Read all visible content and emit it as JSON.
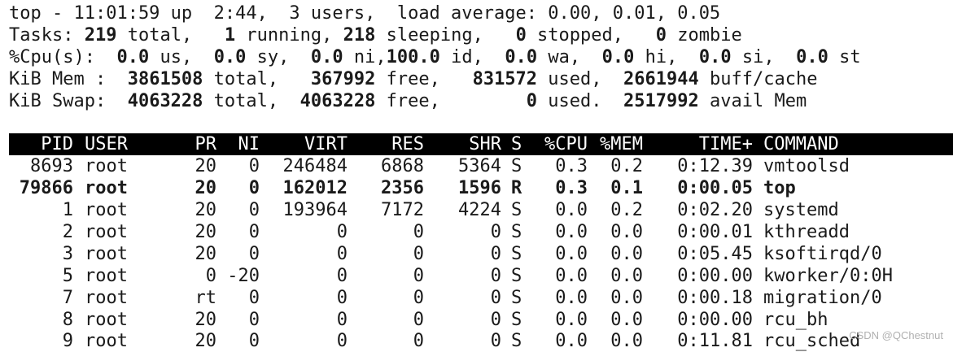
{
  "summary": {
    "l1": {
      "prefix": "top - 11:01:59 up  2:44,  3 users,  load average: 0.00, 0.01, 0.05"
    },
    "l2": {
      "label": "Tasks: ",
      "total": "219",
      "total_txt": " total,   ",
      "running": "1",
      "running_txt": " running, ",
      "sleeping": "218",
      "sleeping_txt": " sleeping,   ",
      "stopped": "0",
      "stopped_txt": " stopped,   ",
      "zombie": "0",
      "zombie_txt": " zombie"
    },
    "l3": {
      "label": "%Cpu(s):  ",
      "us": "0.0",
      "us_txt": " us,  ",
      "sy": "0.0",
      "sy_txt": " sy,  ",
      "ni": "0.0",
      "ni_txt": " ni,",
      "id": "100.0",
      "id_txt": " id,  ",
      "wa": "0.0",
      "wa_txt": " wa,  ",
      "hi": "0.0",
      "hi_txt": " hi,  ",
      "si": "0.0",
      "si_txt": " si,  ",
      "st": "0.0",
      "st_txt": " st"
    },
    "l4": {
      "label": "KiB Mem :  ",
      "total": "3861508",
      "total_txt": " total,   ",
      "free": "367992",
      "free_txt": " free,   ",
      "used": "831572",
      "used_txt": " used,  ",
      "buff": "2661944",
      "buff_txt": " buff/cache"
    },
    "l5": {
      "label": "KiB Swap:  ",
      "total": "4063228",
      "total_txt": " total,  ",
      "free": "4063228",
      "free_txt": " free,        ",
      "used": "0",
      "used_txt": " used.  ",
      "avail": "2517992",
      "avail_txt": " avail Mem"
    }
  },
  "columns": [
    "PID",
    "USER",
    "PR",
    "NI",
    "VIRT",
    "RES",
    "SHR",
    "S",
    "%CPU",
    "%MEM",
    "TIME+",
    "COMMAND"
  ],
  "processes": [
    {
      "pid": "8693",
      "user": "root",
      "pr": "20",
      "ni": "0",
      "virt": "246484",
      "res": "6868",
      "shr": "5364",
      "s": "S",
      "cpu": "0.3",
      "mem": "0.2",
      "time": "0:12.39",
      "command": "vmtoolsd",
      "bold": false
    },
    {
      "pid": "79866",
      "user": "root",
      "pr": "20",
      "ni": "0",
      "virt": "162012",
      "res": "2356",
      "shr": "1596",
      "s": "R",
      "cpu": "0.3",
      "mem": "0.1",
      "time": "0:00.05",
      "command": "top",
      "bold": true
    },
    {
      "pid": "1",
      "user": "root",
      "pr": "20",
      "ni": "0",
      "virt": "193964",
      "res": "7172",
      "shr": "4224",
      "s": "S",
      "cpu": "0.0",
      "mem": "0.2",
      "time": "0:02.20",
      "command": "systemd",
      "bold": false
    },
    {
      "pid": "2",
      "user": "root",
      "pr": "20",
      "ni": "0",
      "virt": "0",
      "res": "0",
      "shr": "0",
      "s": "S",
      "cpu": "0.0",
      "mem": "0.0",
      "time": "0:00.01",
      "command": "kthreadd",
      "bold": false
    },
    {
      "pid": "3",
      "user": "root",
      "pr": "20",
      "ni": "0",
      "virt": "0",
      "res": "0",
      "shr": "0",
      "s": "S",
      "cpu": "0.0",
      "mem": "0.0",
      "time": "0:05.45",
      "command": "ksoftirqd/0",
      "bold": false
    },
    {
      "pid": "5",
      "user": "root",
      "pr": "0",
      "ni": "-20",
      "virt": "0",
      "res": "0",
      "shr": "0",
      "s": "S",
      "cpu": "0.0",
      "mem": "0.0",
      "time": "0:00.00",
      "command": "kworker/0:0H",
      "bold": false
    },
    {
      "pid": "7",
      "user": "root",
      "pr": "rt",
      "ni": "0",
      "virt": "0",
      "res": "0",
      "shr": "0",
      "s": "S",
      "cpu": "0.0",
      "mem": "0.0",
      "time": "0:00.18",
      "command": "migration/0",
      "bold": false
    },
    {
      "pid": "8",
      "user": "root",
      "pr": "20",
      "ni": "0",
      "virt": "0",
      "res": "0",
      "shr": "0",
      "s": "S",
      "cpu": "0.0",
      "mem": "0.0",
      "time": "0:00.00",
      "command": "rcu_bh",
      "bold": false
    },
    {
      "pid": "9",
      "user": "root",
      "pr": "20",
      "ni": "0",
      "virt": "0",
      "res": "0",
      "shr": "0",
      "s": "S",
      "cpu": "0.0",
      "mem": "0.0",
      "time": "0:11.81",
      "command": "rcu_sched",
      "bold": false
    }
  ],
  "watermark": "CSDN @QChestnut"
}
